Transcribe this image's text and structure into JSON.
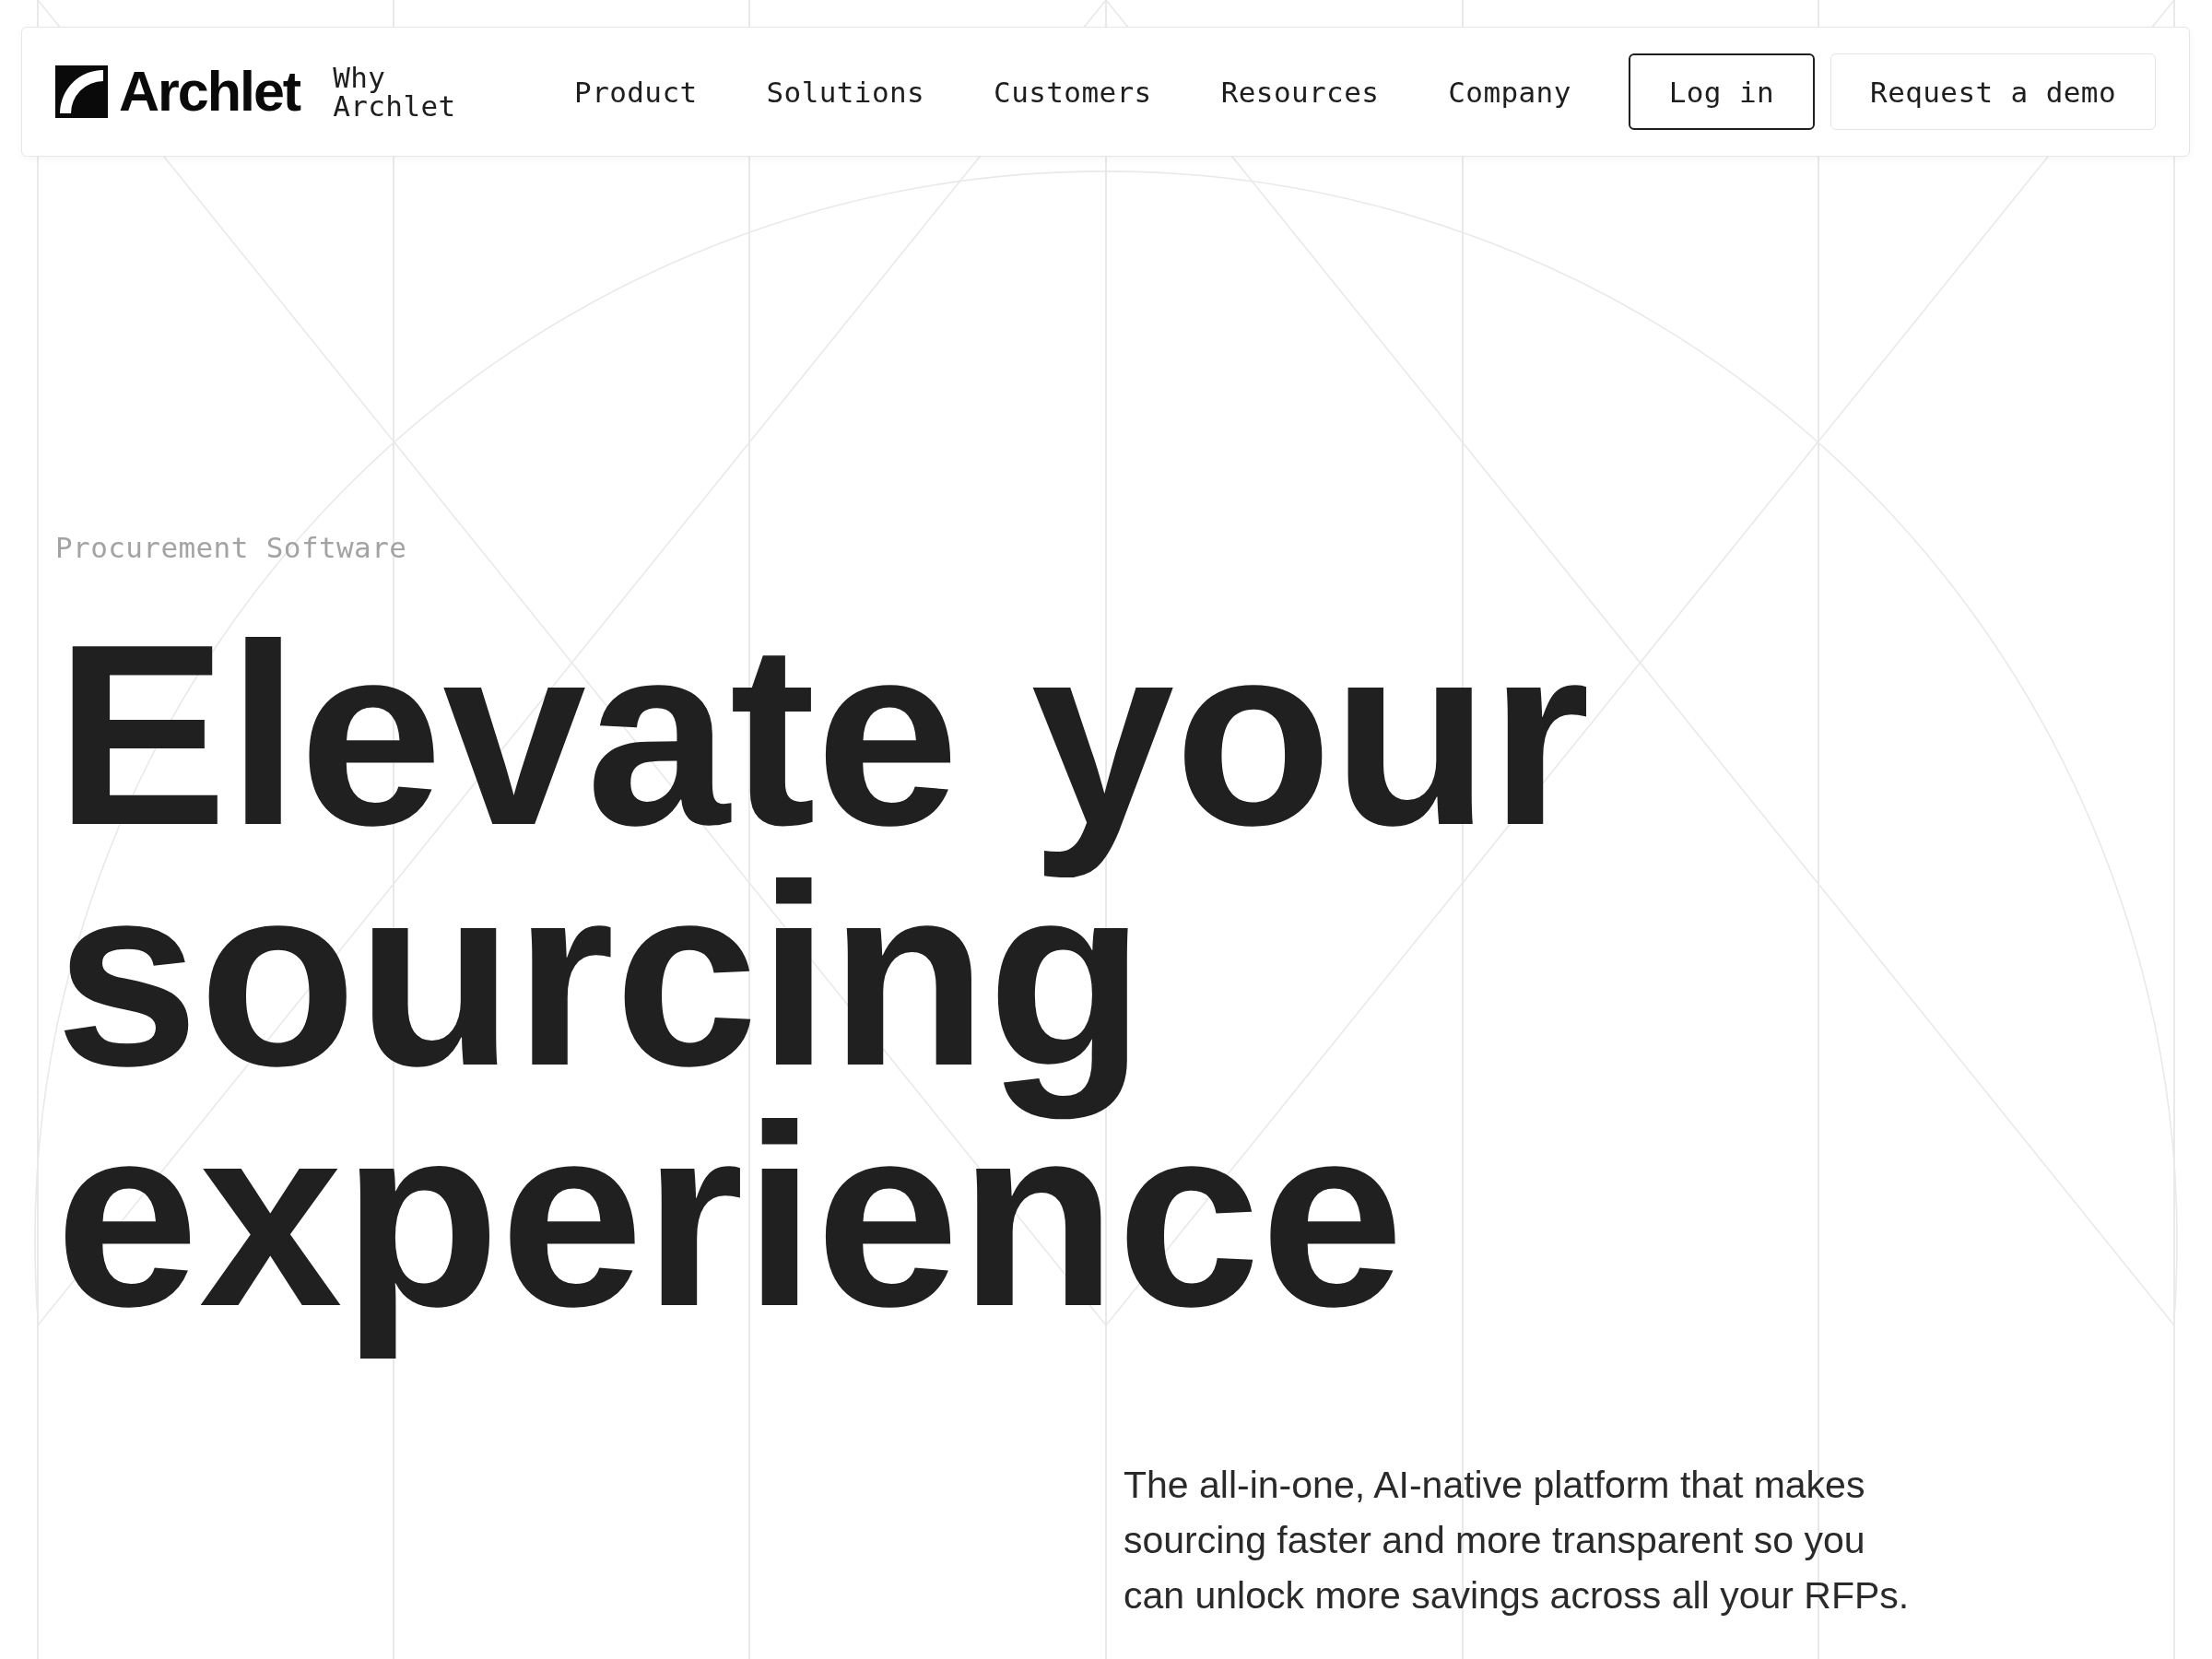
{
  "header": {
    "logo_text": "Archlet",
    "why_link": "Why Archlet",
    "nav": [
      "Product",
      "Solutions",
      "Customers",
      "Resources",
      "Company"
    ],
    "buttons": [
      {
        "label": "Log in",
        "kind": "outline"
      },
      {
        "label": "Request a demo",
        "kind": "subtle"
      }
    ]
  },
  "hero": {
    "eyebrow": "Procurement Software",
    "headline": "Elevate your sourcing experience",
    "description": "The all-in-one, AI-native platform that makes sourcing faster and more transparent so you can unlock more savings across all your RFPs."
  }
}
